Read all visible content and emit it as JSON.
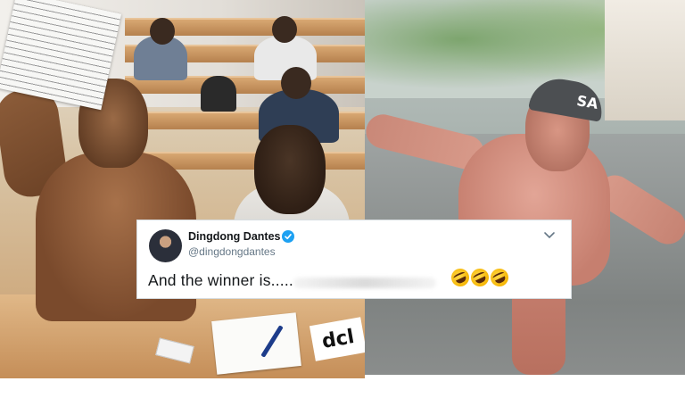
{
  "tweet": {
    "display_name": "Dingdong Dantes",
    "handle": "@dingdongdantes",
    "text": "And the winner is.....",
    "emoji": [
      "rolling-on-floor-laughing-emoji",
      "rolling-on-floor-laughing-emoji",
      "rolling-on-floor-laughing-emoji"
    ],
    "verified": true,
    "verified_color": "#1da1f2"
  },
  "photo_left": {
    "logo_text": "dcl"
  },
  "photo_right": {
    "cap_text": "SA"
  }
}
